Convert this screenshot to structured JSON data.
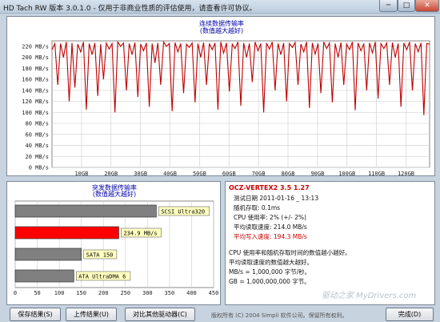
{
  "window": {
    "title": "HD Tach RW 版本 3.0.1.0 - 仅用于非商业性质的评估使用，请查看许可协议。",
    "min": "─",
    "max": "□",
    "close": "✕"
  },
  "sequential": {
    "title": "连续数据传输率",
    "subtitle": "(数值越大越好)",
    "y_ticks": [
      "220 MB/s",
      "200 MB/s",
      "180 MB/s",
      "160 MB/s",
      "140 MB/s",
      "120 MB/s",
      "100 MB/s",
      "80 MB/s",
      "60 MB/s",
      "40 MB/s",
      "20 MB/s",
      "0 MB/s"
    ],
    "x_ticks": [
      "10GB",
      "20GB",
      "30GB",
      "40GB",
      "50GB",
      "60GB",
      "70GB",
      "80GB",
      "90GB",
      "100GB",
      "110GB",
      "120GB"
    ],
    "line_color": "#c00000"
  },
  "burst": {
    "title": "突发数据传输率",
    "subtitle": "(数值越大越好)",
    "x_ticks": [
      "0",
      "50",
      "100",
      "150",
      "200",
      "250",
      "300",
      "350",
      "400",
      "450"
    ],
    "bars": [
      {
        "label": "SCSI Ultra320",
        "value": 320,
        "color": "#808080"
      },
      {
        "label": "234.9 MB/s",
        "value": 234.9,
        "color": "#ff0000"
      },
      {
        "label": "SATA 150",
        "value": 150,
        "color": "#808080"
      },
      {
        "label": "ATA UltraDMA 6",
        "value": 133,
        "color": "#808080"
      }
    ]
  },
  "info": {
    "device": "OCZ-VERTEX2 3.5 1.27",
    "date": "测试日期 2011-01-16 _ 13:13",
    "random": "随机存取: 0.1ms",
    "cpu": "CPU 使用率: 2% (+/- 2%)",
    "read": "平均读取速度: 214.0 MB/s",
    "write": "平均写入速度: 194.3 MB/s",
    "note1": "CPU 使用率和随机存取时间的数值越小越好。",
    "note2": "平均读取速度的数值越大越好。",
    "note3": "MB/s = 1,000,000 字节/秒。",
    "note4": "GB = 1,000,000,000 字节。",
    "watermark": "驱动之家 MyDrivers.com"
  },
  "footer": {
    "save": "保存结果(S)",
    "upload": "上传结果(U)",
    "compare": "对比其他驱动器(C)",
    "copyright": "版权所有 (C) 2004 Simpli 软件公司。保留所有权利。",
    "done": "完成(D)"
  },
  "chart_data": [
    {
      "type": "line",
      "title": "连续数据传输率",
      "subtitle": "(数值越大越好)",
      "xlabel": "",
      "ylabel": "",
      "xlim": [
        0,
        128
      ],
      "ylim": [
        0,
        230
      ],
      "x_tick_labels": [
        "10GB",
        "20GB",
        "30GB",
        "40GB",
        "50GB",
        "60GB",
        "70GB",
        "80GB",
        "90GB",
        "100GB",
        "110GB",
        "120GB"
      ],
      "y_tick_labels": [
        "0 MB/s",
        "20 MB/s",
        "40 MB/s",
        "60 MB/s",
        "80 MB/s",
        "100 MB/s",
        "120 MB/s",
        "140 MB/s",
        "160 MB/s",
        "180 MB/s",
        "200 MB/s",
        "220 MB/s"
      ],
      "series": [
        {
          "values": [
            214,
            225,
            150,
            225,
            200,
            228,
            120,
            226,
            145,
            224,
            210,
            228,
            105,
            225,
            205,
            226,
            130,
            224,
            160,
            226,
            215,
            225,
            100,
            228,
            220,
            226,
            140,
            225,
            205,
            227,
            128,
            224,
            212,
            226,
            110,
            225,
            190,
            226,
            150,
            228,
            220,
            225,
            102,
            227,
            210,
            225,
            135,
            224,
            218,
            226,
            118,
            225,
            200,
            227,
            150,
            225,
            214,
            226,
            105,
            228,
            208,
            226,
            138,
            224,
            216,
            228,
            112,
            226,
            200,
            225,
            155,
            228,
            212,
            225,
            100,
            226,
            215,
            228,
            140,
            225,
            205,
            226,
            120,
            225,
            218,
            227,
            150,
            224,
            210,
            228,
            108,
            226,
            206,
            225,
            135,
            228,
            216,
            226,
            118,
            225,
            200,
            227,
            150,
            224,
            214,
            228,
            104,
            226,
            212,
            225,
            140,
            226,
            208,
            228,
            125,
            225,
            216,
            226,
            150,
            227,
            200,
            225,
            110,
            226,
            214,
            228,
            140,
            225,
            210,
            226,
            95,
            225,
            224
          ]
        }
      ]
    },
    {
      "type": "bar",
      "orientation": "horizontal",
      "title": "突发数据传输率",
      "subtitle": "(数值越大越好)",
      "xlim": [
        0,
        450
      ],
      "categories": [
        "SCSI Ultra320",
        "234.9 MB/s",
        "SATA 150",
        "ATA UltraDMA 6"
      ],
      "values": [
        320,
        234.9,
        150,
        133
      ]
    }
  ]
}
